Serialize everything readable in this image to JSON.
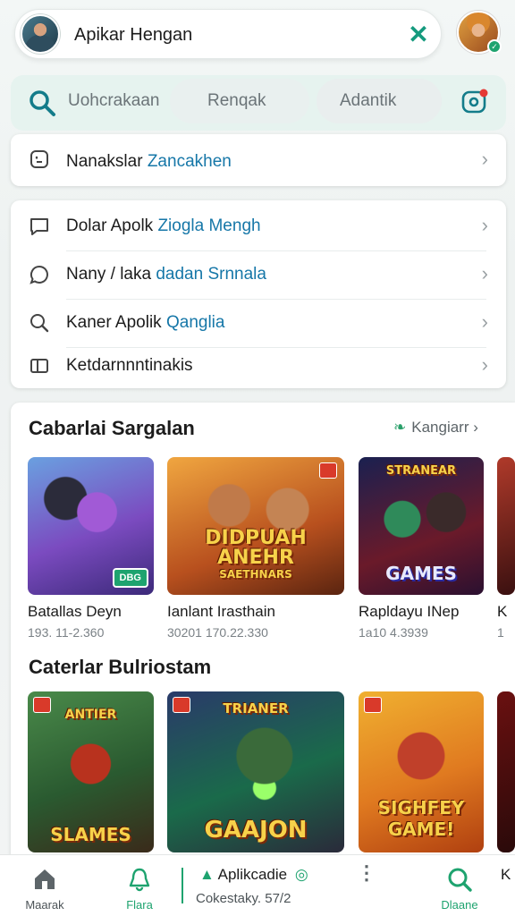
{
  "header": {
    "title": "Apikar Hengan",
    "close_icon": "close-icon"
  },
  "search": {
    "text": "Uohcrakaan",
    "chip_1": "Renqak",
    "chip_2": "Adantik"
  },
  "single_row": {
    "label": "Nanakslar",
    "accent": "Zancakhen"
  },
  "menu": {
    "items": [
      {
        "label": "Dolar Apolk",
        "accent": "Ziogla Mengh",
        "icon": "chat-icon"
      },
      {
        "label": "Nany / laka",
        "accent": "dadan Srnnala",
        "icon": "bubble-icon"
      },
      {
        "label": "Kaner Apolik",
        "accent": "Qanglia",
        "icon": "search-icon"
      },
      {
        "label": "Ketdarnnntinakis",
        "accent": "",
        "icon": "book-icon"
      }
    ]
  },
  "section_1": {
    "title": "Cabarlai Sargalan",
    "see_more": "Kangiarr",
    "games": [
      {
        "name": "Batallas Deyn",
        "meta": "193. 11-2.360",
        "badge": "DBG",
        "art": "purple-hero"
      },
      {
        "name": "Ianlant Irasthain",
        "meta": "30201   170.22.330",
        "art_text": "DIDPUAH ANEHR",
        "art_sub": "SAETHNARS",
        "art": "duo-heroes"
      },
      {
        "name": "Rapldayu INep",
        "meta": "1a10 4.3939",
        "art_text": "GAMES",
        "art_top": "STRANEAR",
        "art": "dark-heroes"
      },
      {
        "name": "K",
        "meta": "1",
        "art": "partial"
      }
    ]
  },
  "section_2": {
    "title": "Caterlar Bulriostam",
    "games": [
      {
        "art_text": "SLAMES",
        "art_top": "ANTIER",
        "art": "soldier"
      },
      {
        "art_text": "GAAJON",
        "art_top": "TRIANER",
        "art": "sniper"
      },
      {
        "art_text": "SIGHFEY GAME!",
        "art": "fighter"
      }
    ]
  },
  "bottom_nav": {
    "home": "Maarak",
    "flare": "Flara",
    "center_title": "Aplikcadie",
    "center_sub": "Cokestaky. 57/2",
    "search": "Dlaane",
    "partial": "K"
  },
  "colors": {
    "accent_green": "#159a7e",
    "link_blue": "#1677a8"
  }
}
